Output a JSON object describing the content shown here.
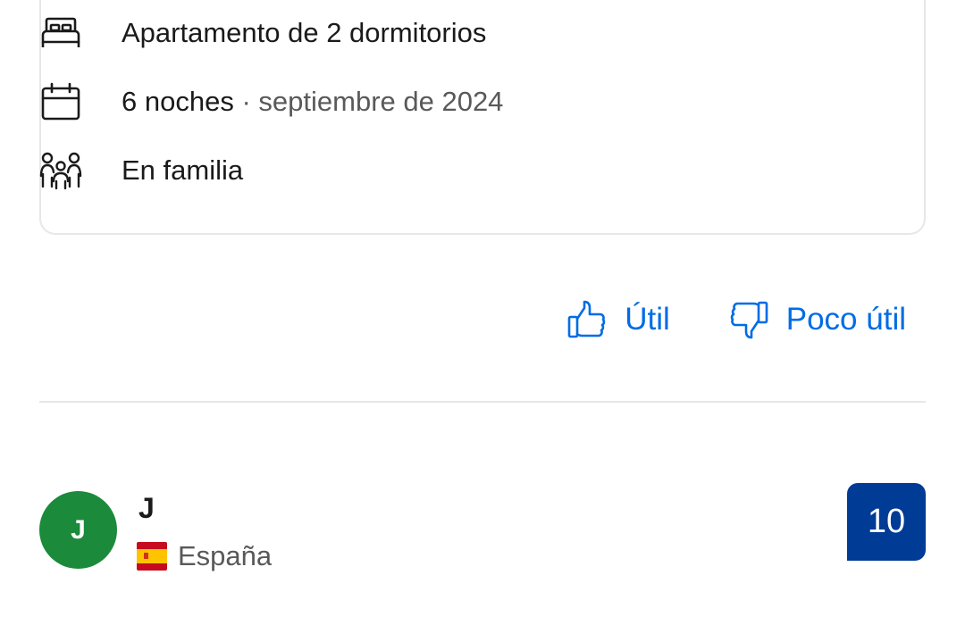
{
  "stay": {
    "room": "Apartamento de 2 dormitorios",
    "nights": "6 noches",
    "separator": "·",
    "date": "septiembre de 2024",
    "traveler_type": "En familia",
    "icons": [
      "bed-icon",
      "calendar-icon",
      "family-icon"
    ]
  },
  "feedback": {
    "helpful_label": "Útil",
    "not_helpful_label": "Poco útil",
    "accent_color": "#006ce4"
  },
  "reviewer": {
    "initial": "J",
    "name": "J",
    "country": "España",
    "flag": "spain-flag-icon",
    "avatar_color": "#1b8a3b",
    "score": "10",
    "score_color": "#003b95"
  }
}
